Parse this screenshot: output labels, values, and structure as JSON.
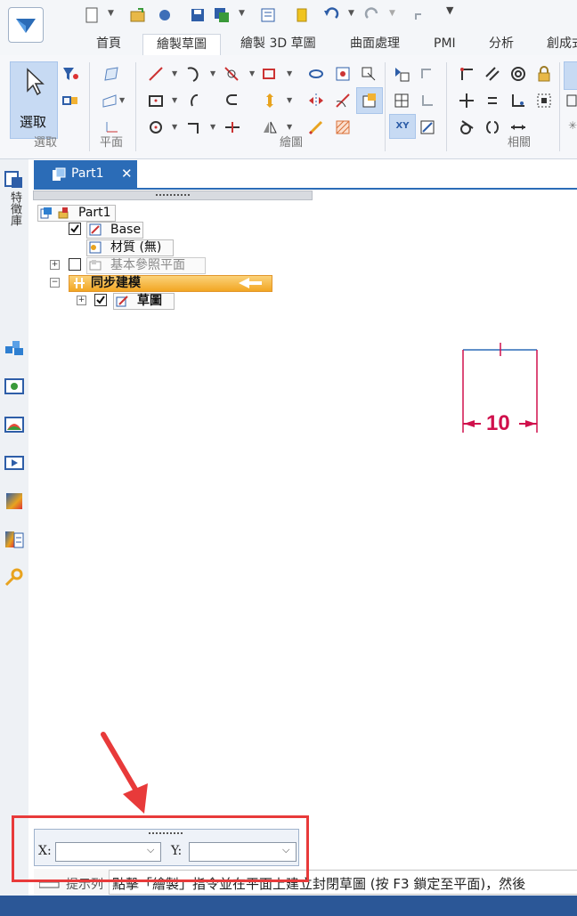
{
  "ribbon_tabs": [
    "首頁",
    "繪製草圖",
    "繪製 3D 草圖",
    "曲面處理",
    "PMI",
    "分析",
    "創成式"
  ],
  "active_tab": "繪製草圖",
  "ribbon_groups": {
    "select": "選取",
    "select_button": "選取",
    "plane": "平面",
    "draw": "繪圖",
    "relate": "相關",
    "xy_label": "XY"
  },
  "left_panel": {
    "title": "特徵庫"
  },
  "document_tab": {
    "title": "Part1",
    "close": "✕"
  },
  "tree": {
    "root": "Part1",
    "base": "Base",
    "material": "材質 (無)",
    "ref_planes": "基本參照平面",
    "sync": "同步建模",
    "sketch": "草圖"
  },
  "dimension": {
    "value": "10"
  },
  "coords": {
    "x_label": "X:",
    "y_label": "Y:",
    "x_value": "",
    "y_value": ""
  },
  "prompt": {
    "label": "提示列",
    "text": "點擊「繪製」指令並在平面上建立封閉草圖 (按 F3 鎖定至平面)，然後"
  },
  "colors": {
    "accent": "#2b6cb7",
    "sync_highlight": "#f7b733",
    "annotation_red": "#e83a3a",
    "dimension": "#d0104c"
  }
}
